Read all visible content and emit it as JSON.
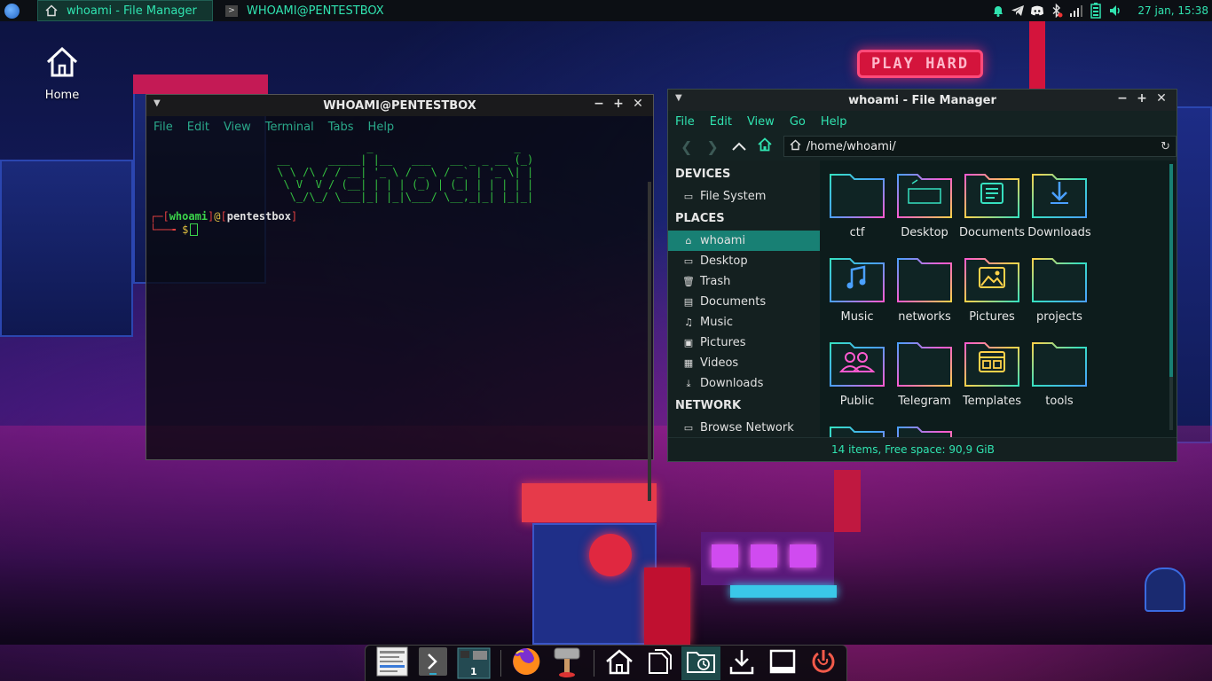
{
  "panel": {
    "tasks": [
      {
        "label": "whoami - File Manager",
        "active": true
      },
      {
        "label": "WHOAMI@PENTESTBOX",
        "active": false
      }
    ],
    "clock": "27 jan, 15:38"
  },
  "desktop": {
    "icons": [
      {
        "label": "Home",
        "icon": "home-icon"
      }
    ]
  },
  "wallpaper": {
    "sign_text": "PLAY HARD"
  },
  "terminal": {
    "title": "WHOAMI@PENTESTBOX",
    "menu": [
      "File",
      "Edit",
      "View",
      "Terminal",
      "Tabs",
      "Help"
    ],
    "ascii_art": "               _                      _ \n __      _____| |__   ___   __ _ _ __ (_)\n \\ \\ /\\ / / __| '_ \\ / _ \\ / _` | '_ \\| |\n  \\ V  V / (__| | | | (_) | (_| | | | | |\n   \\_/\\_/ \\___|_| |_|\\___/ \\__,_|_| |_|_|",
    "prompt_user": "whoami",
    "prompt_at": "@",
    "prompt_host": "pentestbox",
    "prompt_symbol": "$"
  },
  "file_manager": {
    "title": "whoami - File Manager",
    "menu": [
      "File",
      "Edit",
      "View",
      "Go",
      "Help"
    ],
    "location": "/home/whoami/",
    "sidebar": {
      "devices_header": "DEVICES",
      "devices": [
        {
          "label": "File System",
          "icon": "drive-icon"
        }
      ],
      "places_header": "PLACES",
      "places": [
        {
          "label": "whoami",
          "icon": "home-icon",
          "selected": true
        },
        {
          "label": "Desktop",
          "icon": "desktop-icon",
          "selected": false
        },
        {
          "label": "Trash",
          "icon": "trash-icon",
          "selected": false
        },
        {
          "label": "Documents",
          "icon": "documents-icon",
          "selected": false
        },
        {
          "label": "Music",
          "icon": "music-icon",
          "selected": false
        },
        {
          "label": "Pictures",
          "icon": "pictures-icon",
          "selected": false
        },
        {
          "label": "Videos",
          "icon": "videos-icon",
          "selected": false
        },
        {
          "label": "Downloads",
          "icon": "downloads-icon",
          "selected": false
        }
      ],
      "network_header": "NETWORK",
      "network": [
        {
          "label": "Browse Network",
          "icon": "network-icon"
        }
      ]
    },
    "folders": [
      {
        "name": "ctf",
        "glyph": ""
      },
      {
        "name": "Desktop",
        "glyph": "desktop"
      },
      {
        "name": "Documents",
        "glyph": "documents"
      },
      {
        "name": "Downloads",
        "glyph": "downloads"
      },
      {
        "name": "Music",
        "glyph": "music"
      },
      {
        "name": "networks",
        "glyph": ""
      },
      {
        "name": "Pictures",
        "glyph": "pictures"
      },
      {
        "name": "projects",
        "glyph": ""
      },
      {
        "name": "Public",
        "glyph": "public"
      },
      {
        "name": "Telegram",
        "glyph": ""
      },
      {
        "name": "Templates",
        "glyph": "templates"
      },
      {
        "name": "tools",
        "glyph": ""
      },
      {
        "name": "",
        "glyph": ""
      },
      {
        "name": "",
        "glyph": ""
      }
    ],
    "status": "14 items, Free space: 90,9 GiB"
  },
  "dock": {
    "workspace_number": "1",
    "items": [
      "task-manager-icon",
      "terminal-icon",
      "workspace-switcher-icon",
      "firefox-icon",
      "hammer-icon",
      "home-folder-icon",
      "files-icon",
      "recent-folder-icon",
      "downloads-icon",
      "window-icon",
      "power-icon"
    ]
  },
  "colors": {
    "accent": "#30e3b0",
    "selection": "#188074",
    "terminal_green": "#3bd44b",
    "folder_gradient": [
      "#36e0c0",
      "#4aa0ff",
      "#ff5ad0",
      "#ffd24a"
    ]
  }
}
